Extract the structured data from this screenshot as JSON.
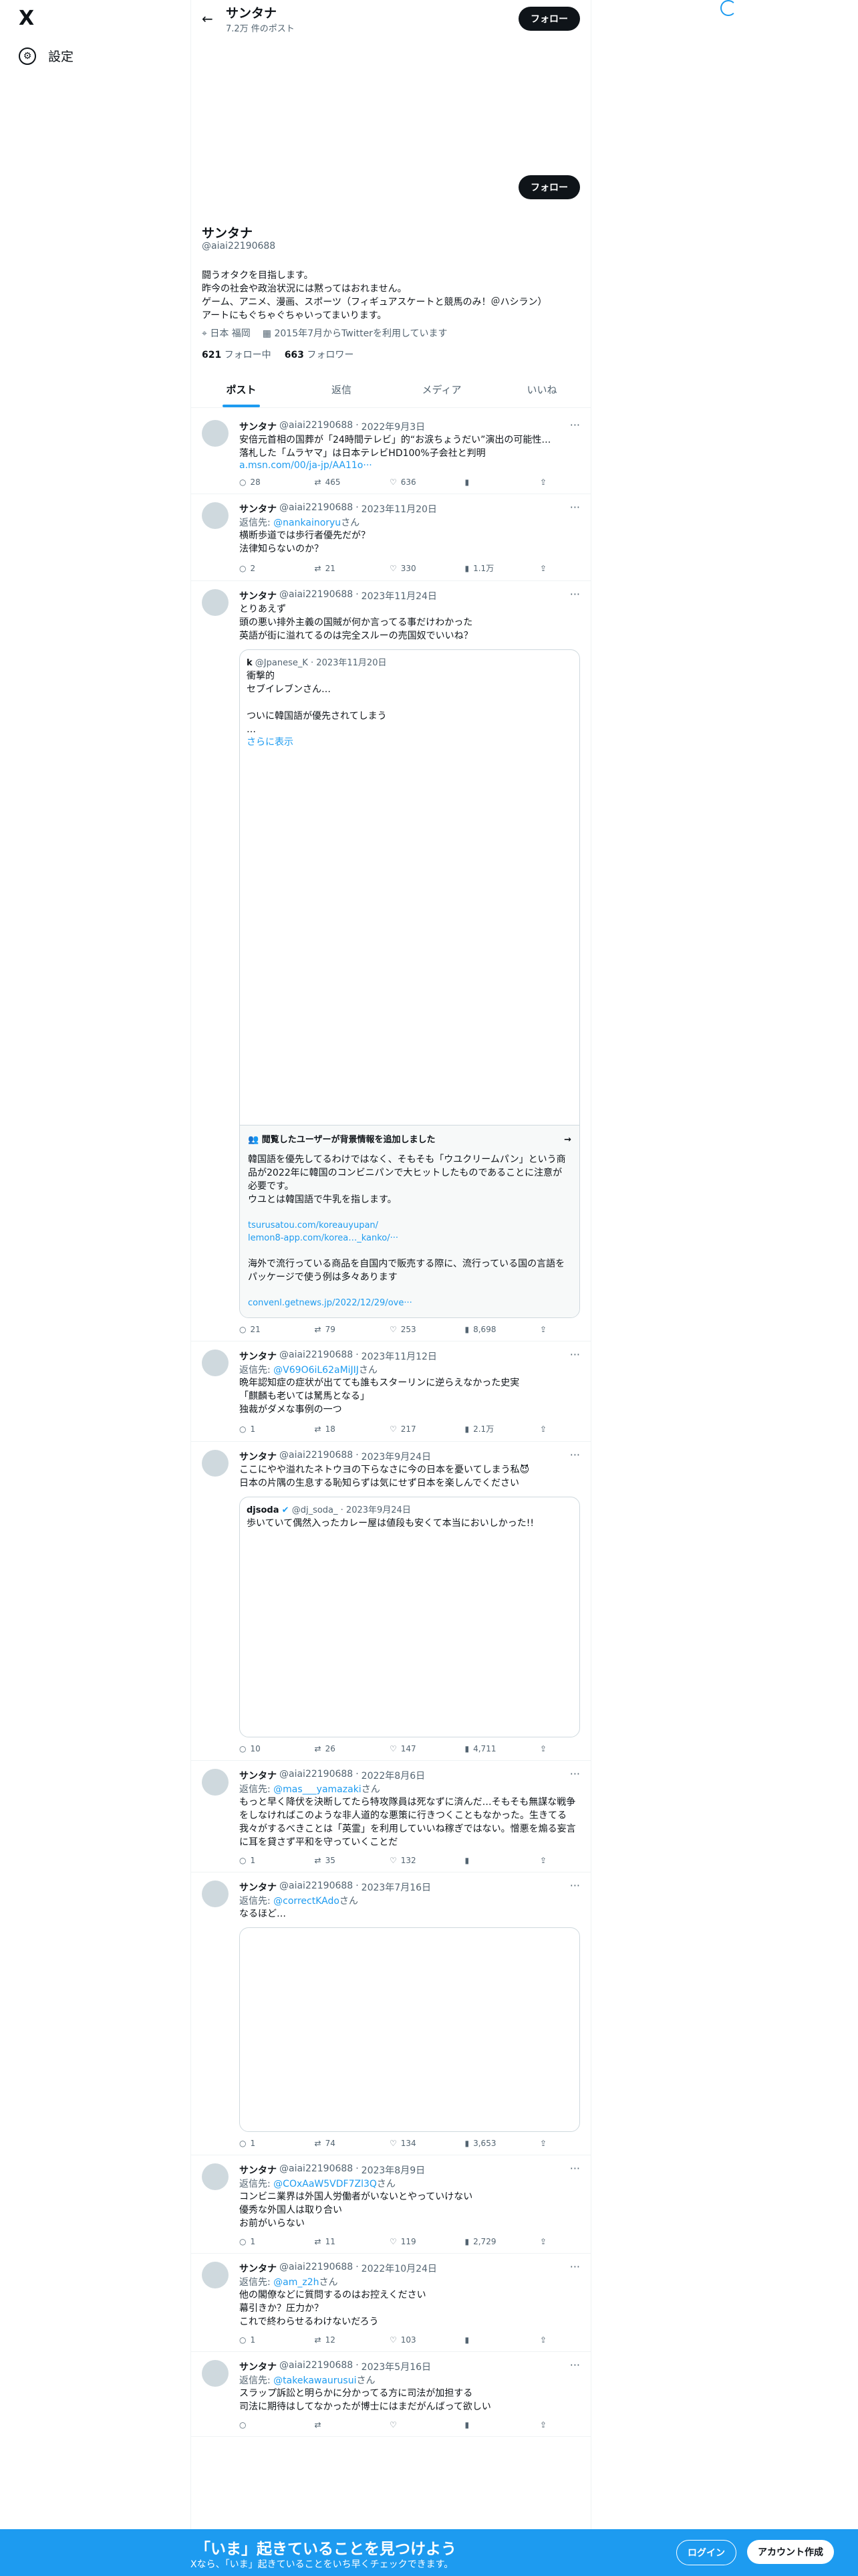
{
  "nav": {
    "logo": "X",
    "settings": "設定"
  },
  "header": {
    "name": "サンタナ",
    "post_count": "7.2万 件のポスト",
    "follow": "フォロー"
  },
  "profile": {
    "name": "サンタナ",
    "handle": "@aiai22190688",
    "bio": "闘うオタクを目指します。\n昨今の社会や政治状況には黙ってはおれません。\nゲーム、アニメ、漫画、スポーツ（フィギュアスケートと競馬のみ！＠ハシラン）\nアートにもぐちゃぐちゃいってまいります。",
    "location": "日本 福岡",
    "joined": "2015年7月からTwitterを利用しています",
    "following_count": "621",
    "following_label": "フォロー中",
    "followers_count": "663",
    "followers_label": "フォロワー",
    "follow_button": "フォロー"
  },
  "tabs": [
    "ポスト",
    "返信",
    "メディア",
    "いいね"
  ],
  "tweets": [
    {
      "name": "サンタナ",
      "handle": "@aiai22190688",
      "date": "2022年9月3日",
      "reply_to": "",
      "text": "安倍元首相の国葬が「24時間テレビ」的“お涙ちょうだい”演出の可能性…\n落札した「ムラヤマ」は日本テレビHD100%子会社と判明",
      "link": "a.msn.com/00/ja-jp/AA11o···",
      "reply": "28",
      "repost": "465",
      "like": "636",
      "views": ""
    },
    {
      "name": "サンタナ",
      "handle": "@aiai22190688",
      "date": "2023年11月20日",
      "reply_to": "@nankainoryu",
      "text": "横断歩道では歩行者優先だが？\n法律知らないのか？",
      "link": "",
      "reply": "2",
      "repost": "21",
      "like": "330",
      "views": "1.1万"
    },
    {
      "name": "サンタナ",
      "handle": "@aiai22190688",
      "date": "2023年11月24日",
      "reply_to": "",
      "text": "とりあえず\n頭の悪い排外主義の国賊が何か言ってる事だけわかった\n英語が街に溢れてるのは完全スルーの売国奴でいいね？",
      "link": "",
      "reply": "21",
      "repost": "79",
      "like": "253",
      "views": "8,698"
    },
    {
      "name": "サンタナ",
      "handle": "@aiai22190688",
      "date": "2023年11月12日",
      "reply_to": "@V69O6iL62aMiJIJ",
      "text": "晩年認知症の症状が出てても誰もスターリンに逆らえなかった史実\n「麒麟も老いては駑馬となる」\n独裁がダメな事例の一つ",
      "link": "",
      "reply": "1",
      "repost": "18",
      "like": "217",
      "views": "2.1万"
    },
    {
      "name": "サンタナ",
      "handle": "@aiai22190688",
      "date": "2023年9月24日",
      "reply_to": "",
      "text": "ここにやや溢れたネトウヨの下らなさに今の日本を憂いてしまう私😈\n日本の片隅の生息する恥知らずは気にせず日本を楽しんでください",
      "link": "",
      "reply": "10",
      "repost": "26",
      "like": "147",
      "views": "4,711"
    },
    {
      "name": "サンタナ",
      "handle": "@aiai22190688",
      "date": "2022年8月6日",
      "reply_to": "@mas___yamazaki",
      "text": "もっと早く降伏を決断してたら特攻隊員は死なずに済んだ…そもそも無謀な戦争をしなければこのような非人道的な悪策に行きつくこともなかった。生きてる我々がするべきことは「英霊」を利用していいね稼ぎではない。憎悪を煽る妄言に耳を貸さず平和を守っていくことだ",
      "link": "",
      "reply": "1",
      "repost": "35",
      "like": "132",
      "views": ""
    },
    {
      "name": "サンタナ",
      "handle": "@aiai22190688",
      "date": "2023年7月16日",
      "reply_to": "@correctKAdo",
      "text": "なるほど…",
      "link": "",
      "reply": "1",
      "repost": "74",
      "like": "134",
      "views": "3,653"
    },
    {
      "name": "サンタナ",
      "handle": "@aiai22190688",
      "date": "2023年8月9日",
      "reply_to": "@COxAaW5VDF7Zl3Q",
      "text": "コンビニ業界は外国人労働者がいないとやっていけない\n優秀な外国人は取り合い\nお前がいらない",
      "link": "",
      "reply": "1",
      "repost": "11",
      "like": "119",
      "views": "2,729"
    },
    {
      "name": "サンタナ",
      "handle": "@aiai22190688",
      "date": "2022年10月24日",
      "reply_to": "@am_z2h",
      "text": "他の閣僚などに質問するのはお控えください\n幕引きか？圧力か？\nこれで終わらせるわけないだろう",
      "link": "",
      "reply": "1",
      "repost": "12",
      "like": "103",
      "views": ""
    },
    {
      "name": "サンタナ",
      "handle": "@aiai22190688",
      "date": "2023年5月16日",
      "reply_to": "@takekawaurusui",
      "text": "スラップ訴訟と明らかに分かってる方に司法が加担する\n司法に期待はしてなかったが博士にはまだがんばって欲しい",
      "link": "",
      "reply": "",
      "repost": "",
      "like": "",
      "views": ""
    }
  ],
  "quote1": {
    "name": "k",
    "handle": "@Jpanese_K",
    "date": "2023年11月20日",
    "text": "衝撃的\nセブイレブンさん…\n\nついに韓国語が優先されてしまう\n…",
    "more": "さらに表示"
  },
  "note": {
    "title": "閲覧したユーザーが背景情報を追加しました",
    "text1": "韓国語を優先してるわけではなく、そもそも「ウユクリームパン」という商品が2022年に韓国のコンビニパンで大ヒットしたものであることに注意が必要です。\nウユとは韓国語で牛乳を指します。",
    "link1": "tsurusatou.com/koreauyupan/",
    "link2": "lemon8-app.com/korea…_kanko/···",
    "text2": "海外で流行っている商品を自国内で販売する際に、流行っている国の言語をパッケージで使う例は多々あります",
    "link3": "convenl.getnews.jp/2022/12/29/ove···"
  },
  "quote2": {
    "name": "djsoda",
    "handle": "@dj_soda_",
    "date": "2023年9月24日",
    "text": "歩いていて偶然入ったカレー屋は値段も安くて本当においしかった!!"
  },
  "bottom": {
    "title": "「いま」起きていることを見つけよう",
    "subtitle": "Xなら、「いま」起きていることをいち早くチェックできます。",
    "login": "ログイン",
    "signup": "アカウント作成"
  }
}
